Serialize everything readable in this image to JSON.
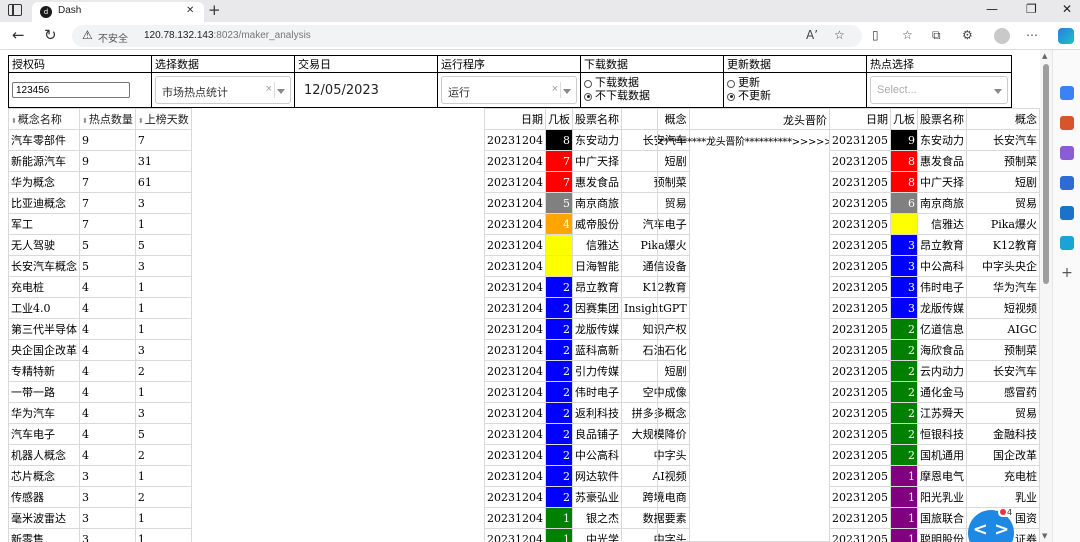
{
  "browser": {
    "tab_title": "Dash",
    "security_text": "不安全",
    "url_host": "120.78.132.143",
    "url_path": ":8023/maker_analysis",
    "read_aloud": "A’"
  },
  "header": {
    "labels": [
      "授权码",
      "选择数据",
      "交易日",
      "运行程序",
      "下载数据",
      "更新数据",
      "热点选择"
    ],
    "auth_code": "123456",
    "data_select": "市场热点统计",
    "trade_date": "12/05/2023",
    "program": "运行",
    "download_options": [
      "下载数据",
      "不下载数据"
    ],
    "download_selected": 1,
    "update_options": [
      "更新",
      "不更新"
    ],
    "update_selected": 1,
    "hotspot_placeholder": "Select..."
  },
  "hotspot_table": {
    "columns": [
      "概念名称",
      "热点数量",
      "上榜天数"
    ],
    "rows": [
      [
        "汽车零部件",
        "9",
        "7"
      ],
      [
        "新能源汽车",
        "9",
        "31"
      ],
      [
        "华为概念",
        "7",
        "61"
      ],
      [
        "比亚迪概念",
        "7",
        "3"
      ],
      [
        "军工",
        "7",
        "1"
      ],
      [
        "无人驾驶",
        "5",
        "5"
      ],
      [
        "长安汽车概念",
        "5",
        "3"
      ],
      [
        "充电桩",
        "4",
        "1"
      ],
      [
        "工业4.0",
        "4",
        "1"
      ],
      [
        "第三代半导体",
        "4",
        "1"
      ],
      [
        "央企国企改革",
        "4",
        "3"
      ],
      [
        "专精特新",
        "4",
        "2"
      ],
      [
        "一带一路",
        "4",
        "1"
      ],
      [
        "华为汽车",
        "4",
        "3"
      ],
      [
        "汽车电子",
        "4",
        "5"
      ],
      [
        "机器人概念",
        "4",
        "2"
      ],
      [
        "芯片概念",
        "3",
        "1"
      ],
      [
        "传感器",
        "3",
        "2"
      ],
      [
        "毫米波雷达",
        "3",
        "1"
      ],
      [
        "新零售",
        "3",
        "1"
      ]
    ]
  },
  "dragon_left": {
    "columns": [
      "日期",
      "几板",
      "股票名称",
      "概念"
    ],
    "rows": [
      [
        "20231204",
        "8",
        "东安动力",
        "长安汽车",
        "#000000"
      ],
      [
        "20231204",
        "7",
        "中广天择",
        "短剧",
        "#ff0000"
      ],
      [
        "20231204",
        "7",
        "惠发食品",
        "预制菜",
        "#ff0000"
      ],
      [
        "20231204",
        "5",
        "南京商旅",
        "贸易",
        "#808080"
      ],
      [
        "20231204",
        "4",
        "威帝股份",
        "汽车电子",
        "#ffa500"
      ],
      [
        "20231204",
        "3",
        "信雅达",
        "Pika爆火",
        "#ffff00"
      ],
      [
        "20231204",
        "3",
        "日海智能",
        "通信设备",
        "#ffff00"
      ],
      [
        "20231204",
        "2",
        "昂立教育",
        "K12教育",
        "#0000ff"
      ],
      [
        "20231204",
        "2",
        "因赛集团",
        "InsightGPT",
        "#0000ff"
      ],
      [
        "20231204",
        "2",
        "龙版传媒",
        "知识产权",
        "#0000ff"
      ],
      [
        "20231204",
        "2",
        "蓝科高新",
        "石油石化",
        "#0000ff"
      ],
      [
        "20231204",
        "2",
        "引力传媒",
        "短剧",
        "#0000ff"
      ],
      [
        "20231204",
        "2",
        "伟时电子",
        "空中成像",
        "#0000ff"
      ],
      [
        "20231204",
        "2",
        "返利科技",
        "拼多多概念",
        "#0000ff"
      ],
      [
        "20231204",
        "2",
        "良品铺子",
        "大规模降价",
        "#0000ff"
      ],
      [
        "20231204",
        "2",
        "中公高科",
        "中字头",
        "#0000ff"
      ],
      [
        "20231204",
        "2",
        "网达软件",
        "AI视频",
        "#0000ff"
      ],
      [
        "20231204",
        "2",
        "苏豪弘业",
        "跨境电商",
        "#0000ff"
      ],
      [
        "20231204",
        "1",
        "银之杰",
        "数据要素",
        "#008000"
      ],
      [
        "20231204",
        "1",
        "中光学",
        "中字头",
        "#008000"
      ]
    ]
  },
  "dragon_mid": {
    "header": "龙头晋阶",
    "first_row": "**********龙头晋阶**********>>>>>"
  },
  "dragon_right": {
    "columns": [
      "日期",
      "几板",
      "股票名称",
      "概念"
    ],
    "rows": [
      [
        "20231205",
        "9",
        "东安动力",
        "长安汽车",
        "#000000"
      ],
      [
        "20231205",
        "8",
        "惠发食品",
        "预制菜",
        "#ff0000"
      ],
      [
        "20231205",
        "8",
        "中广天择",
        "短剧",
        "#ff0000"
      ],
      [
        "20231205",
        "6",
        "南京商旅",
        "贸易",
        "#808080"
      ],
      [
        "20231205",
        "4",
        "信雅达",
        "Pika爆火",
        "#ffff00"
      ],
      [
        "20231205",
        "3",
        "昂立教育",
        "K12教育",
        "#0000ff"
      ],
      [
        "20231205",
        "3",
        "中公高科",
        "中字头央企",
        "#0000ff"
      ],
      [
        "20231205",
        "3",
        "伟时电子",
        "华为汽车",
        "#0000ff"
      ],
      [
        "20231205",
        "3",
        "龙版传媒",
        "短视频",
        "#0000ff"
      ],
      [
        "20231205",
        "2",
        "亿道信息",
        "AIGC",
        "#008000"
      ],
      [
        "20231205",
        "2",
        "海欣食品",
        "预制菜",
        "#008000"
      ],
      [
        "20231205",
        "2",
        "云内动力",
        "长安汽车",
        "#008000"
      ],
      [
        "20231205",
        "2",
        "通化金马",
        "感冒药",
        "#008000"
      ],
      [
        "20231205",
        "2",
        "江苏舜天",
        "贸易",
        "#008000"
      ],
      [
        "20231205",
        "2",
        "恒银科技",
        "金融科技",
        "#008000"
      ],
      [
        "20231205",
        "2",
        "国机通用",
        "国企改革",
        "#008000"
      ],
      [
        "20231205",
        "1",
        "摩恩电气",
        "充电桩",
        "#800080"
      ],
      [
        "20231205",
        "1",
        "阳光乳业",
        "乳业",
        "#800080"
      ],
      [
        "20231205",
        "1",
        "国旅联合",
        "国资",
        "#800080"
      ],
      [
        "20231205",
        "1",
        "聪明股份",
        "证券",
        "#800080"
      ]
    ]
  },
  "float_widget": {
    "label": "< >",
    "badge": "4"
  }
}
